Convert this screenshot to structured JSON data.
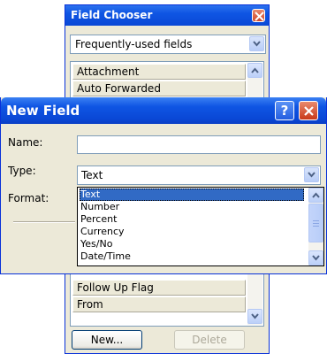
{
  "field_chooser": {
    "title": "Field Chooser",
    "category": "Frequently-used fields",
    "items": [
      "Attachment",
      "Auto Forwarded",
      "Follow Up Flag",
      "From"
    ],
    "new_button": "New...",
    "delete_button": "Delete"
  },
  "new_field": {
    "title": "New Field",
    "help_glyph": "?",
    "name_label": "Name:",
    "name_value": "",
    "type_label": "Type:",
    "type_value": "Text",
    "format_label": "Format:",
    "type_options": [
      "Text",
      "Number",
      "Percent",
      "Currency",
      "Yes/No",
      "Date/Time"
    ],
    "selected_option": "Text"
  },
  "colors": {
    "title_bar_blue": "#0a48d6",
    "selection_blue": "#316ac5",
    "dialog_face": "#ece9d8",
    "close_red": "#d2492a"
  }
}
